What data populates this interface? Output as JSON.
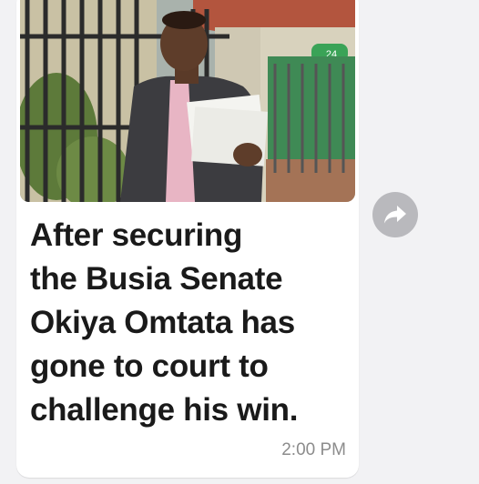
{
  "message": {
    "caption_lines": [
      "After securing",
      "the Busia Senate",
      "Okiya Omtata has",
      "gone to court to",
      "challenge his win."
    ],
    "time": "2:00 PM",
    "photo_badge_number": "24"
  },
  "icons": {
    "forward": "forward-arrow-icon"
  },
  "colors": {
    "app_background": "#f2f2f4",
    "bubble_background": "#ffffff",
    "caption_text": "#1a1a1a",
    "timestamp_text": "#8c8c8c",
    "forward_button": "#b9b9bd"
  }
}
